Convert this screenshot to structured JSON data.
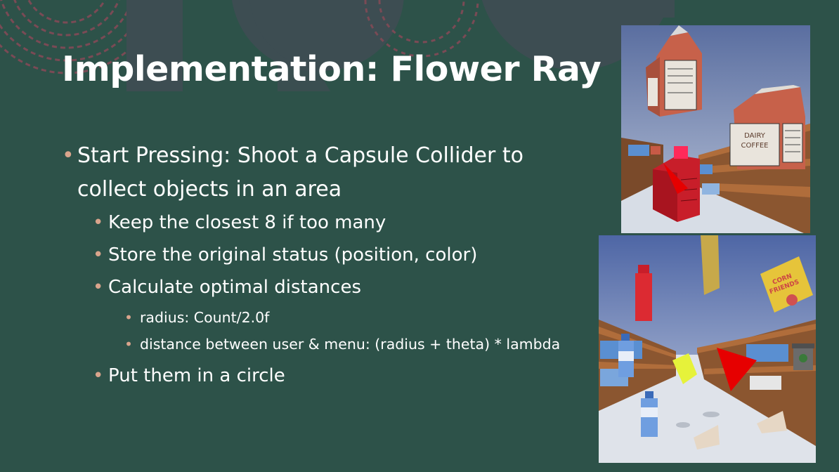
{
  "slide": {
    "title": "Implementation: Flower Ray",
    "bullets": [
      {
        "text": "Start Pressing: Shoot a Capsule Collider to collect objects in an area"
      },
      {
        "text": "Keep the closest 8 if too many"
      },
      {
        "text": "Store the original status (position, color)"
      },
      {
        "text": "Calculate optimal distances"
      },
      {
        "text": "radius: Count/2.0f"
      },
      {
        "text": "distance between user & menu: (radius + theta) * lambda"
      },
      {
        "text": "Put them in a circle"
      }
    ],
    "bullet_glyph": "•"
  },
  "screenshot_top": {
    "carton_large": {
      "lines": [
        "DAIRY",
        "COFFEE"
      ]
    },
    "carton_small_label": "DAIRY COFFEE"
  },
  "screenshot_bottom": {
    "cereal_box": {
      "lines": [
        "CORN",
        "FRIENDS"
      ]
    }
  },
  "colors": {
    "background": "#2d5249",
    "title": "#ffffff",
    "bullet": "#d9a48c",
    "arc_decoration": "#7a4a55",
    "shape_decoration": "#3d4d52",
    "pointer_red": "#e60000"
  }
}
